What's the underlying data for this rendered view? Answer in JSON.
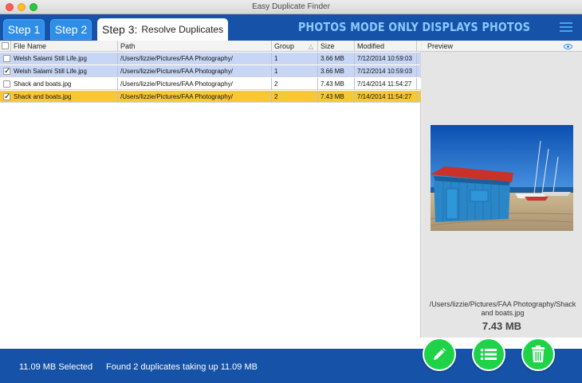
{
  "window": {
    "title": "Easy Duplicate Finder"
  },
  "header": {
    "tabs": [
      {
        "label": "Step 1"
      },
      {
        "label": "Step 2"
      },
      {
        "label_step": "Step 3:",
        "label_name": "Resolve Duplicates"
      }
    ],
    "mode_text": "PHOTOS MODE ONLY DISPLAYS PHOTOS",
    "menu_icon": "hamburger-menu-icon"
  },
  "table": {
    "columns": [
      "File Name",
      "Path",
      "Group",
      "Size",
      "Modified"
    ],
    "sort_indicator": "△",
    "rows": [
      {
        "checked": false,
        "file": "Welsh Salami Still Life.jpg",
        "path": "/Users/lizzie/Pictures/FAA Photography/",
        "group": "1",
        "size": "3.66 MB",
        "modified": "7/12/2014 10:59:03",
        "style": "blue"
      },
      {
        "checked": true,
        "file": "Welsh Salami Still Life.jpg",
        "path": "/Users/lizzie/Pictures/FAA Photography/",
        "group": "1",
        "size": "3.66 MB",
        "modified": "7/12/2014 10:59:03",
        "style": "blue"
      },
      {
        "checked": false,
        "file": "Shack and boats.jpg",
        "path": "/Users/lizzie/Pictures/FAA Photography/",
        "group": "2",
        "size": "7.43 MB",
        "modified": "7/14/2014 11:54:27",
        "style": "white"
      },
      {
        "checked": true,
        "file": "Shack and boats.jpg",
        "path": "/Users/lizzie/Pictures/FAA Photography/",
        "group": "2",
        "size": "7.43 MB",
        "modified": "7/14/2014 11:54:27",
        "style": "yellow"
      }
    ]
  },
  "preview": {
    "label": "Preview",
    "path": "/Users/lizzie/Pictures/FAA Photography/Shack and boats.jpg",
    "size": "7.43 MB"
  },
  "footer": {
    "selected": "11.09 MB Selected",
    "found": "Found 2 duplicates taking up 11.09 MB",
    "buttons": [
      "pencil-icon",
      "list-icon",
      "trash-icon"
    ]
  },
  "colors": {
    "brand_blue": "#1552a8",
    "tab_blue": "#2e8ee8",
    "selected_row": "#f8c734",
    "group_row": "#c8d6f5",
    "action_green": "#1ed348"
  }
}
